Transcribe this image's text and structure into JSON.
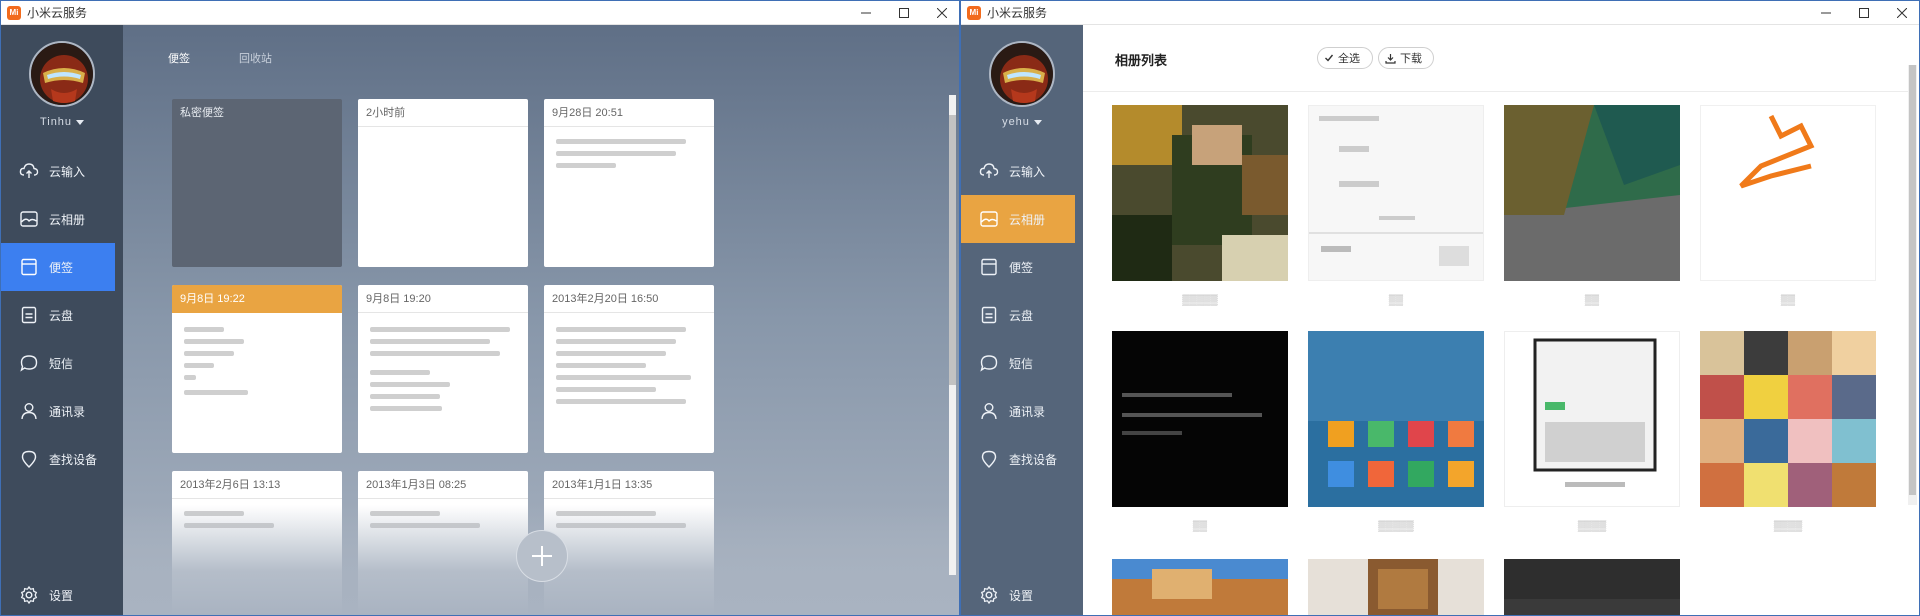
{
  "app": {
    "title": "小米云服务",
    "logo_text": "Mi"
  },
  "nav_labels": {
    "cloud_input": "云输入",
    "cloud_album": "云相册",
    "notes": "便签",
    "cloud_disk": "云盘",
    "sms": "短信",
    "contacts": "通讯录",
    "find_device": "查找设备",
    "settings": "设置"
  },
  "left_window": {
    "username": "Tinhu",
    "tabs": {
      "notes": "便签",
      "recycle_bin": "回收站"
    },
    "notes": [
      {
        "header": "私密便签"
      },
      {
        "header": "2小时前"
      },
      {
        "header": "9月28日 20:51"
      },
      {
        "header": "9月8日 19:22"
      },
      {
        "header": "9月8日 19:20"
      },
      {
        "header": "2013年2月20日 16:50"
      },
      {
        "header": "2013年2月6日 13:13"
      },
      {
        "header": "2013年1月3日 08:25"
      },
      {
        "header": "2013年1月1日 13:35"
      }
    ]
  },
  "right_window": {
    "username": "yehu",
    "album_list_title": "相册列表",
    "select_all": "全选",
    "download": "下载"
  },
  "colors": {
    "left_active": "#3c7ff0",
    "right_active": "#e9a442",
    "note_highlight": "#e9a442"
  }
}
